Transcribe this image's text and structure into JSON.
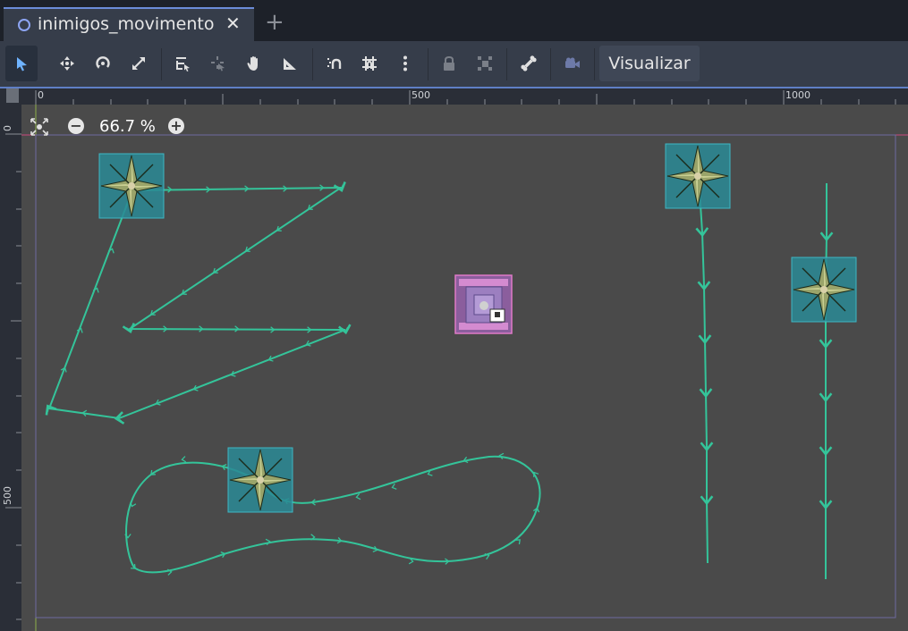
{
  "tab": {
    "title": "inimigos_movimento",
    "close_icon": "close-icon",
    "add_icon": "plus-icon"
  },
  "toolbar": {
    "tools": [
      "select-tool",
      "move-tool",
      "rotate-tool",
      "scale-tool",
      "list-select-tool",
      "pivot-tool",
      "pan-tool",
      "ruler-tool",
      "smart-snap-toggle",
      "grid-snap-toggle",
      "snap-options-menu",
      "lock-tool",
      "group-tool",
      "skeleton-tool",
      "camera-override-tool"
    ],
    "view_menu_label": "Visualizar"
  },
  "ruler": {
    "top_labels": [
      "0",
      "500",
      "1000"
    ],
    "left_labels": [
      "0",
      "500"
    ]
  },
  "zoom": {
    "value": "66.7 %",
    "minus_icon": "zoom-out-icon",
    "plus_icon": "zoom-in-icon",
    "reset_icon": "center-view-icon"
  },
  "colors": {
    "path": "#34c49a",
    "sprite_bg": "#2a8a95",
    "player_box": "#d56ab5",
    "canvas_bg": "#4a4a4a",
    "accent": "#6b8cd8"
  }
}
